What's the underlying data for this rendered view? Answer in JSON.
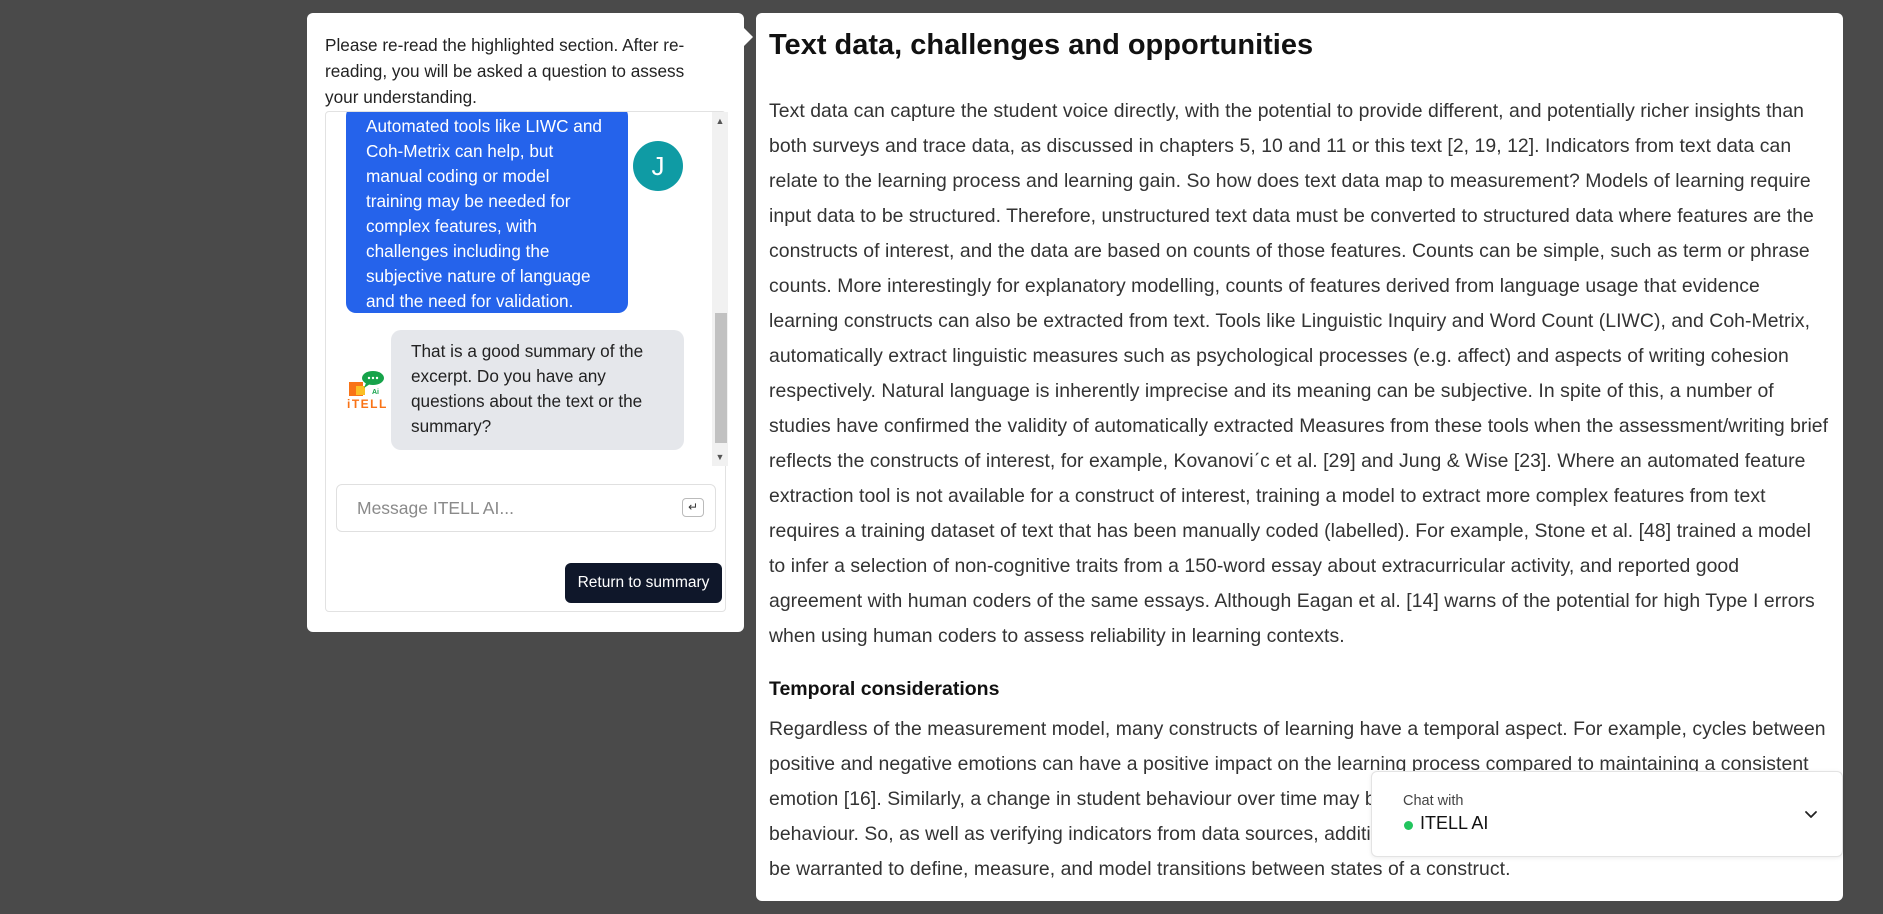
{
  "article": {
    "title": "Text data, challenges and opportunities",
    "paragraph1": "Text data can capture the student voice directly, with the potential to provide different, and potentially richer insights than both surveys and trace data, as discussed in chapters 5, 10 and 11 or this text [2, 19, 12]. Indicators from text data can relate to the learning process and learning gain. So how does text data map to measurement? Models of learning require input data to be structured. Therefore, unstructured text data must be converted to structured data where features are the constructs of interest, and the data are based on counts of those features. Counts can be simple, such as term or phrase counts. More interestingly for explanatory modelling, counts of features derived from language usage that evidence learning constructs can also be extracted from text. Tools like Linguistic Inquiry and Word Count (LIWC), and Coh-Metrix, automatically extract linguistic measures such as psychological processes (e.g. affect) and aspects of writing cohesion respectively. Natural language is inherently imprecise and its meaning can be subjective. In spite of this, a number of studies have confirmed the validity of automatically extracted Measures from these tools when the assessment/writing brief reflects the constructs of interest, for example, Kovanoviˊc et al. [29] and Jung & Wise [23]. Where an automated feature extraction tool is not available for a construct of interest, training a model to extract more complex features from text requires a training dataset of text that has been manually coded (labelled). For example, Stone et al. [48] trained a model to infer a selection of non-cognitive traits from a 150-word essay about extracurricular activity, and reported good agreement with human coders of the same essays. Although Eagan et al. [14] warns of the potential for high Type I errors when using human coders to assess reliability in learning contexts.",
    "subheading": "Temporal considerations",
    "paragraph2": "Regardless of the measurement model, many constructs of learning have a temporal aspect. For example, cycles between positive and negative emotions can have a positive impact on the learning process compared to maintaining a consistent emotion [16]. Similarly, a change in student behaviour over time may be more meaningful than an aggregate of their behaviour. So, as well as verifying indicators from data sources, additional checks and balances in the evidence chain may be warranted to define, measure, and model transitions between states of a construct."
  },
  "popup": {
    "instruction": "Please re-read the highlighted section. After re-reading, you will be asked a question to assess your understanding.",
    "user_message": "Automated tools like LIWC and Coh-Metrix can help, but manual coding or model training may be needed for complex features, with challenges including the subjective nature of language and the need for validation.",
    "user_avatar": "J",
    "bot_message": "That is a good summary of the excerpt. Do you have any questions about the text or the summary?",
    "logo_text": "iTELL",
    "logo_ai": "Ai",
    "input_placeholder": "Message ITELL AI...",
    "enter_symbol": "↵",
    "return_button": "Return to summary",
    "scroll_up": "▲",
    "scroll_down": "▼"
  },
  "chat_widget": {
    "label": "Chat with",
    "name": "ITELL AI",
    "status_color": "#22c55e"
  },
  "colors": {
    "user_bubble": "#2563eb",
    "bot_bubble": "#e5e7eb",
    "avatar": "#0f9ba4",
    "button": "#0f172a",
    "backdrop": "#4a4a4a"
  }
}
